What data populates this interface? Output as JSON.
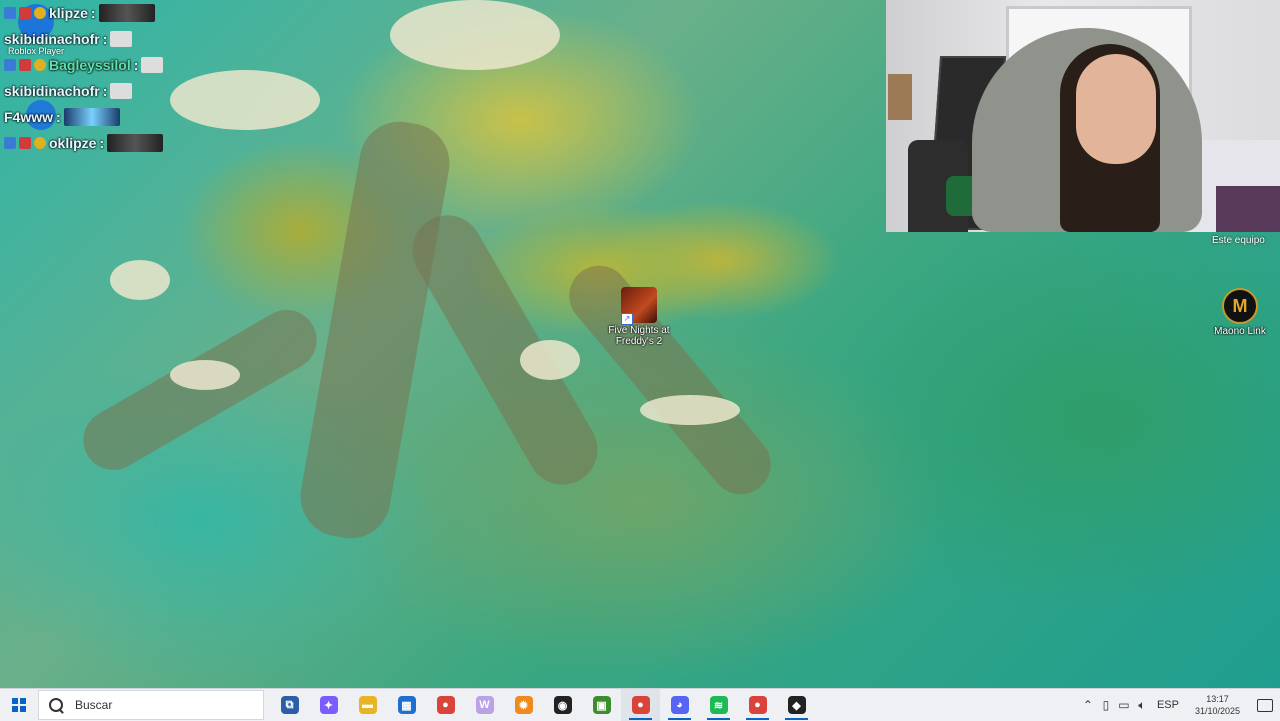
{
  "chat": {
    "lines": [
      {
        "user": "klipze",
        "suffix": ":"
      },
      {
        "user": "skibidinachofr",
        "suffix": ":"
      },
      {
        "user": "Bagleyssilol",
        "suffix": ":"
      },
      {
        "user": "skibidinachofr",
        "suffix": ":"
      },
      {
        "user": "F4www",
        "suffix": ":"
      },
      {
        "user": "oklipze",
        "suffix": ":"
      }
    ],
    "roblox_label": "Roblox Player"
  },
  "webcam": {
    "label": "Este equipo"
  },
  "desktop_icons": [
    {
      "label": "Five Nights at Freddy's 2",
      "icon": "fnaf-icon"
    },
    {
      "label": "Maono Link",
      "icon": "maono-icon",
      "glyph": "M"
    }
  ],
  "taskbar": {
    "search_placeholder": "Buscar",
    "apps": [
      {
        "name": "task-view",
        "glyph": "⧉",
        "color": "#2b5ea7"
      },
      {
        "name": "copilot",
        "glyph": "✦",
        "color": "#7a5cff"
      },
      {
        "name": "file-explorer",
        "glyph": "▬",
        "color": "#e8b324"
      },
      {
        "name": "microsoft-store",
        "glyph": "▦",
        "color": "#1f6fd1"
      },
      {
        "name": "chrome",
        "glyph": "●",
        "color": "#d9433a"
      },
      {
        "name": "wps",
        "glyph": "W",
        "color": "#b9a2e6"
      },
      {
        "name": "roblox-studio",
        "glyph": "✹",
        "color": "#f08a1c"
      },
      {
        "name": "music-player",
        "glyph": "◉",
        "color": "#222222"
      },
      {
        "name": "minecraft",
        "glyph": "▣",
        "color": "#3d8c2f"
      },
      {
        "name": "chrome-profile",
        "glyph": "●",
        "color": "#d9433a"
      },
      {
        "name": "discord",
        "glyph": "◕",
        "color": "#5865f2"
      },
      {
        "name": "spotify",
        "glyph": "≋",
        "color": "#1db954"
      },
      {
        "name": "chrome-profile-2",
        "glyph": "●",
        "color": "#d9433a"
      },
      {
        "name": "roblox",
        "glyph": "◆",
        "color": "#222222"
      }
    ],
    "tray": {
      "language": "ESP",
      "time": "13:17",
      "date": "31/10/2025"
    }
  },
  "colors": {
    "taskbar_bg": "#eef0f4",
    "accent": "#0a64c8"
  }
}
